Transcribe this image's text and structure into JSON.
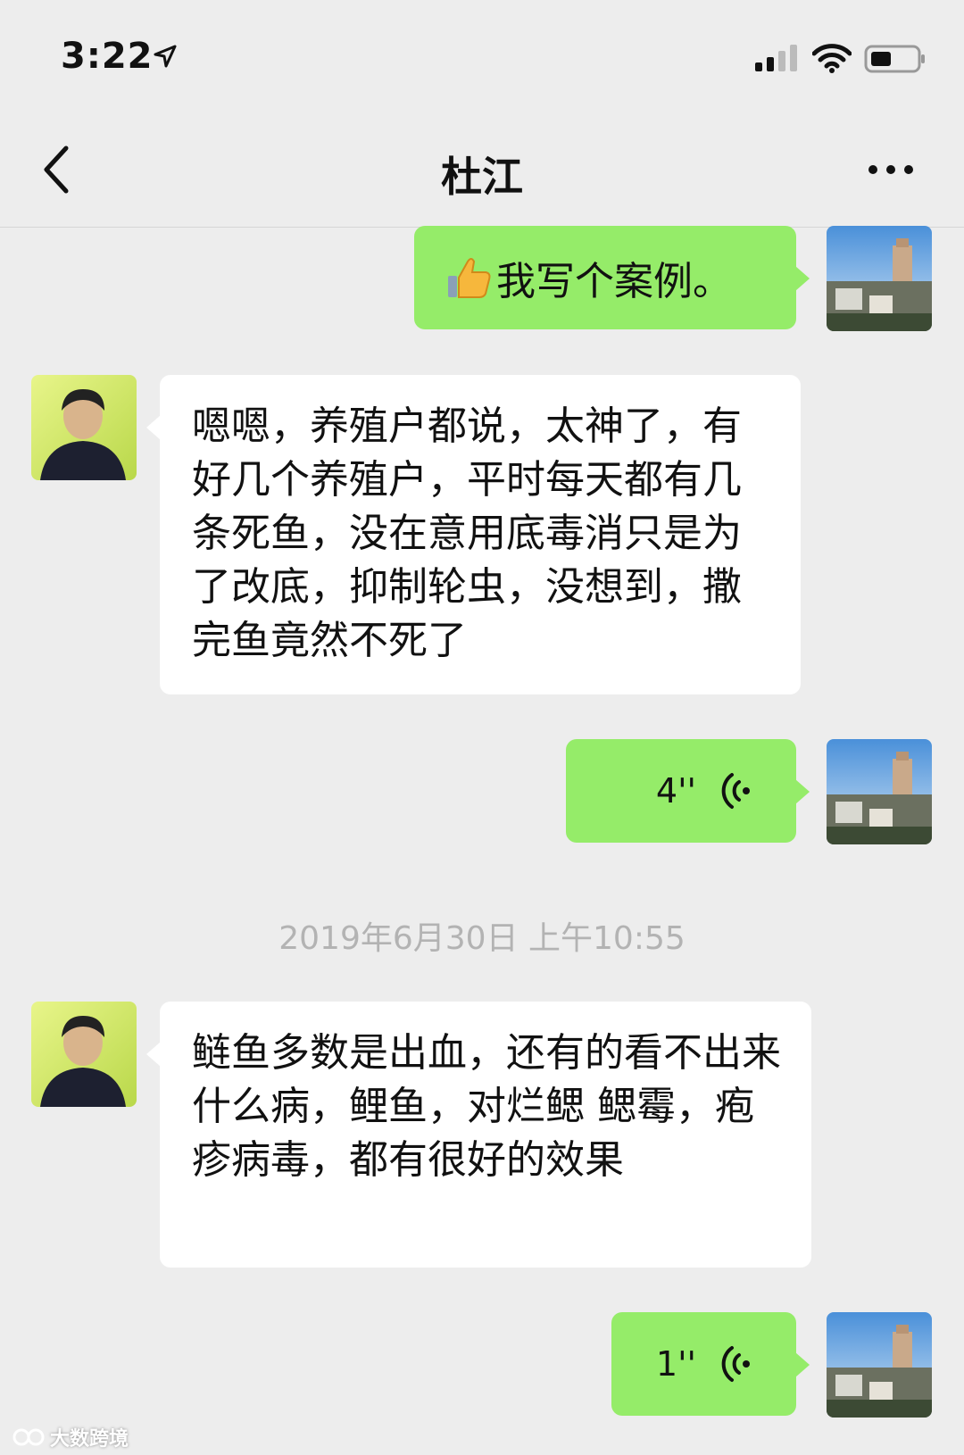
{
  "status_bar": {
    "time": "3:22",
    "icons": [
      "location-arrow-icon",
      "signal-icon",
      "wifi-icon",
      "battery-icon"
    ]
  },
  "nav": {
    "title": "杜江",
    "back_icon": "chevron-left-icon",
    "more_icon": "more-dots-icon"
  },
  "messages": [
    {
      "side": "right",
      "type": "text",
      "emoji": "thumbs-up-icon",
      "text": "我写个案例。"
    },
    {
      "side": "left",
      "type": "text",
      "text": "嗯嗯，养殖户都说，太神了，有好几个养殖户，平时每天都有几条死鱼，没在意用底毒消只是为了改底，抑制轮虫，没想到，撒完鱼竟然不死了"
    },
    {
      "side": "right",
      "type": "voice",
      "duration": "4''"
    },
    {
      "side": "left",
      "type": "text",
      "text": "鲢鱼多数是出血，还有的看不出来什么病，鲤鱼，对烂鳃 鳃霉，疱疹病毒，都有很好的效果"
    },
    {
      "side": "right",
      "type": "voice",
      "duration": "1''"
    }
  ],
  "timestamp": "2019年6月30日 上午10:55",
  "watermark": "大数跨境",
  "colors": {
    "background": "#ededed",
    "sent_bubble": "#95ec69",
    "received_bubble": "#ffffff",
    "timestamp_text": "#b3b3b3"
  }
}
